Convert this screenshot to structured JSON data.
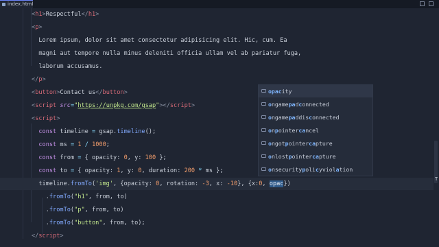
{
  "tab": {
    "label": "index.html"
  },
  "colors": {
    "background": "#1f2532",
    "tag": "#d86b78",
    "keyword": "#c792ea",
    "function": "#82aaff",
    "string": "#c3e88d",
    "number": "#f29d6c",
    "match": "#7fb6ff"
  },
  "code_lines": [
    [
      [
        "br",
        "<"
      ],
      [
        "tag",
        "h1"
      ],
      [
        "br",
        ">"
      ],
      [
        "plain",
        "Respectful"
      ],
      [
        "br",
        "</"
      ],
      [
        "tag",
        "h1"
      ],
      [
        "br",
        ">"
      ]
    ],
    [
      [
        "br",
        "<"
      ],
      [
        "tag",
        "p"
      ],
      [
        "br",
        ">"
      ]
    ],
    [
      [
        "plain",
        "  Lorem ipsum, dolor sit amet consectetur adipisicing elit. Hic, cum. Ea"
      ]
    ],
    [
      [
        "plain",
        "  magni aut tempore nulla minus deleniti officia ullam vel ab pariatur fuga,"
      ]
    ],
    [
      [
        "plain",
        "  laborum accusamus."
      ]
    ],
    [
      [
        "br",
        "</"
      ],
      [
        "tag",
        "p"
      ],
      [
        "br",
        ">"
      ]
    ],
    [
      [
        "br",
        "<"
      ],
      [
        "tag",
        "button"
      ],
      [
        "br",
        ">"
      ],
      [
        "plain",
        "Contact us"
      ],
      [
        "br",
        "</"
      ],
      [
        "tag",
        "button"
      ],
      [
        "br",
        ">"
      ]
    ],
    [
      [
        "br",
        "<"
      ],
      [
        "tag",
        "script"
      ],
      [
        "plain",
        " "
      ],
      [
        "attr",
        "src"
      ],
      [
        "op",
        "="
      ],
      [
        "str",
        "\""
      ],
      [
        "url",
        "https://unpkg.com/gsap"
      ],
      [
        "str",
        "\""
      ],
      [
        "br",
        "></"
      ],
      [
        "tag",
        "script"
      ],
      [
        "br",
        ">"
      ]
    ],
    [
      [
        "br",
        "<"
      ],
      [
        "tag",
        "script"
      ],
      [
        "br",
        ">"
      ]
    ],
    [
      [
        "plain",
        "  "
      ],
      [
        "kw",
        "const"
      ],
      [
        "plain",
        " timeline "
      ],
      [
        "op",
        "="
      ],
      [
        "plain",
        " gsap."
      ],
      [
        "fn",
        "timeline"
      ],
      [
        "plain",
        "();"
      ]
    ],
    [
      [
        "plain",
        "  "
      ],
      [
        "kw",
        "const"
      ],
      [
        "plain",
        " ms "
      ],
      [
        "op",
        "="
      ],
      [
        "plain",
        " "
      ],
      [
        "num",
        "1"
      ],
      [
        "plain",
        " "
      ],
      [
        "op",
        "/"
      ],
      [
        "plain",
        " "
      ],
      [
        "num",
        "1000"
      ],
      [
        "plain",
        ";"
      ]
    ],
    [
      [
        "plain",
        "  "
      ],
      [
        "kw",
        "const"
      ],
      [
        "plain",
        " from "
      ],
      [
        "op",
        "="
      ],
      [
        "plain",
        " { opacity: "
      ],
      [
        "num",
        "0"
      ],
      [
        "plain",
        ", y: "
      ],
      [
        "num",
        "100"
      ],
      [
        "plain",
        " };"
      ]
    ],
    [
      [
        "plain",
        "  "
      ],
      [
        "kw",
        "const"
      ],
      [
        "plain",
        " to "
      ],
      [
        "op",
        "="
      ],
      [
        "plain",
        " { opacity: "
      ],
      [
        "num",
        "1"
      ],
      [
        "plain",
        ", y: "
      ],
      [
        "num",
        "0"
      ],
      [
        "plain",
        ", duration: "
      ],
      [
        "num",
        "200"
      ],
      [
        "plain",
        " "
      ],
      [
        "op",
        "*"
      ],
      [
        "plain",
        " ms };"
      ]
    ],
    [
      [
        "plain",
        "  timeline."
      ],
      [
        "fn",
        "fromTo"
      ],
      [
        "plain",
        "("
      ],
      [
        "str",
        "'img'"
      ],
      [
        "plain",
        ", {opacity: "
      ],
      [
        "num",
        "0"
      ],
      [
        "plain",
        ", rotation: "
      ],
      [
        "num",
        "-3"
      ],
      [
        "plain",
        ", x: "
      ],
      [
        "num",
        "-10"
      ],
      [
        "plain",
        "}, {x:"
      ],
      [
        "num",
        "0"
      ],
      [
        "plain",
        ", "
      ],
      [
        "sel",
        "opac"
      ],
      [
        "plain",
        "})"
      ]
    ],
    [
      [
        "plain",
        "    ."
      ],
      [
        "fn",
        "fromTo"
      ],
      [
        "plain",
        "("
      ],
      [
        "str",
        "\"h1\""
      ],
      [
        "plain",
        ", from, to)"
      ]
    ],
    [
      [
        "plain",
        "    ."
      ],
      [
        "fn",
        "fromTo"
      ],
      [
        "plain",
        "("
      ],
      [
        "str",
        "\"p\""
      ],
      [
        "plain",
        ", from, to)"
      ]
    ],
    [
      [
        "plain",
        "    ."
      ],
      [
        "fn",
        "fromTo"
      ],
      [
        "plain",
        "("
      ],
      [
        "str",
        "\"button\""
      ],
      [
        "plain",
        ", from, to);"
      ]
    ],
    [
      [
        "br",
        "</"
      ],
      [
        "tag",
        "script"
      ],
      [
        "br",
        ">"
      ]
    ]
  ],
  "suggestions": [
    [
      [
        "b",
        "opac"
      ],
      [
        "t",
        "ity"
      ]
    ],
    [
      [
        "b",
        "o"
      ],
      [
        "t",
        "ngame"
      ],
      [
        "b",
        "pa"
      ],
      [
        "t",
        "d"
      ],
      [
        "b",
        "c"
      ],
      [
        "t",
        "onnected"
      ]
    ],
    [
      [
        "b",
        "o"
      ],
      [
        "t",
        "ngame"
      ],
      [
        "b",
        "pa"
      ],
      [
        "t",
        "ddis"
      ],
      [
        "b",
        "c"
      ],
      [
        "t",
        "onnected"
      ]
    ],
    [
      [
        "b",
        "o"
      ],
      [
        "t",
        "n"
      ],
      [
        "b",
        "p"
      ],
      [
        "t",
        "ointer"
      ],
      [
        "b",
        "ca"
      ],
      [
        "t",
        "ncel"
      ]
    ],
    [
      [
        "b",
        "o"
      ],
      [
        "t",
        "ngot"
      ],
      [
        "b",
        "p"
      ],
      [
        "t",
        "ointer"
      ],
      [
        "b",
        "ca"
      ],
      [
        "t",
        "pture"
      ]
    ],
    [
      [
        "b",
        "o"
      ],
      [
        "t",
        "nlost"
      ],
      [
        "b",
        "p"
      ],
      [
        "t",
        "ointer"
      ],
      [
        "b",
        "ca"
      ],
      [
        "t",
        "pture"
      ]
    ],
    [
      [
        "b",
        "o"
      ],
      [
        "t",
        "nsecurity"
      ],
      [
        "b",
        "p"
      ],
      [
        "t",
        "oli"
      ],
      [
        "b",
        "c"
      ],
      [
        "t",
        "yviol"
      ],
      [
        "b",
        "a"
      ],
      [
        "t",
        "tion"
      ]
    ]
  ],
  "hint_glyph": "T"
}
